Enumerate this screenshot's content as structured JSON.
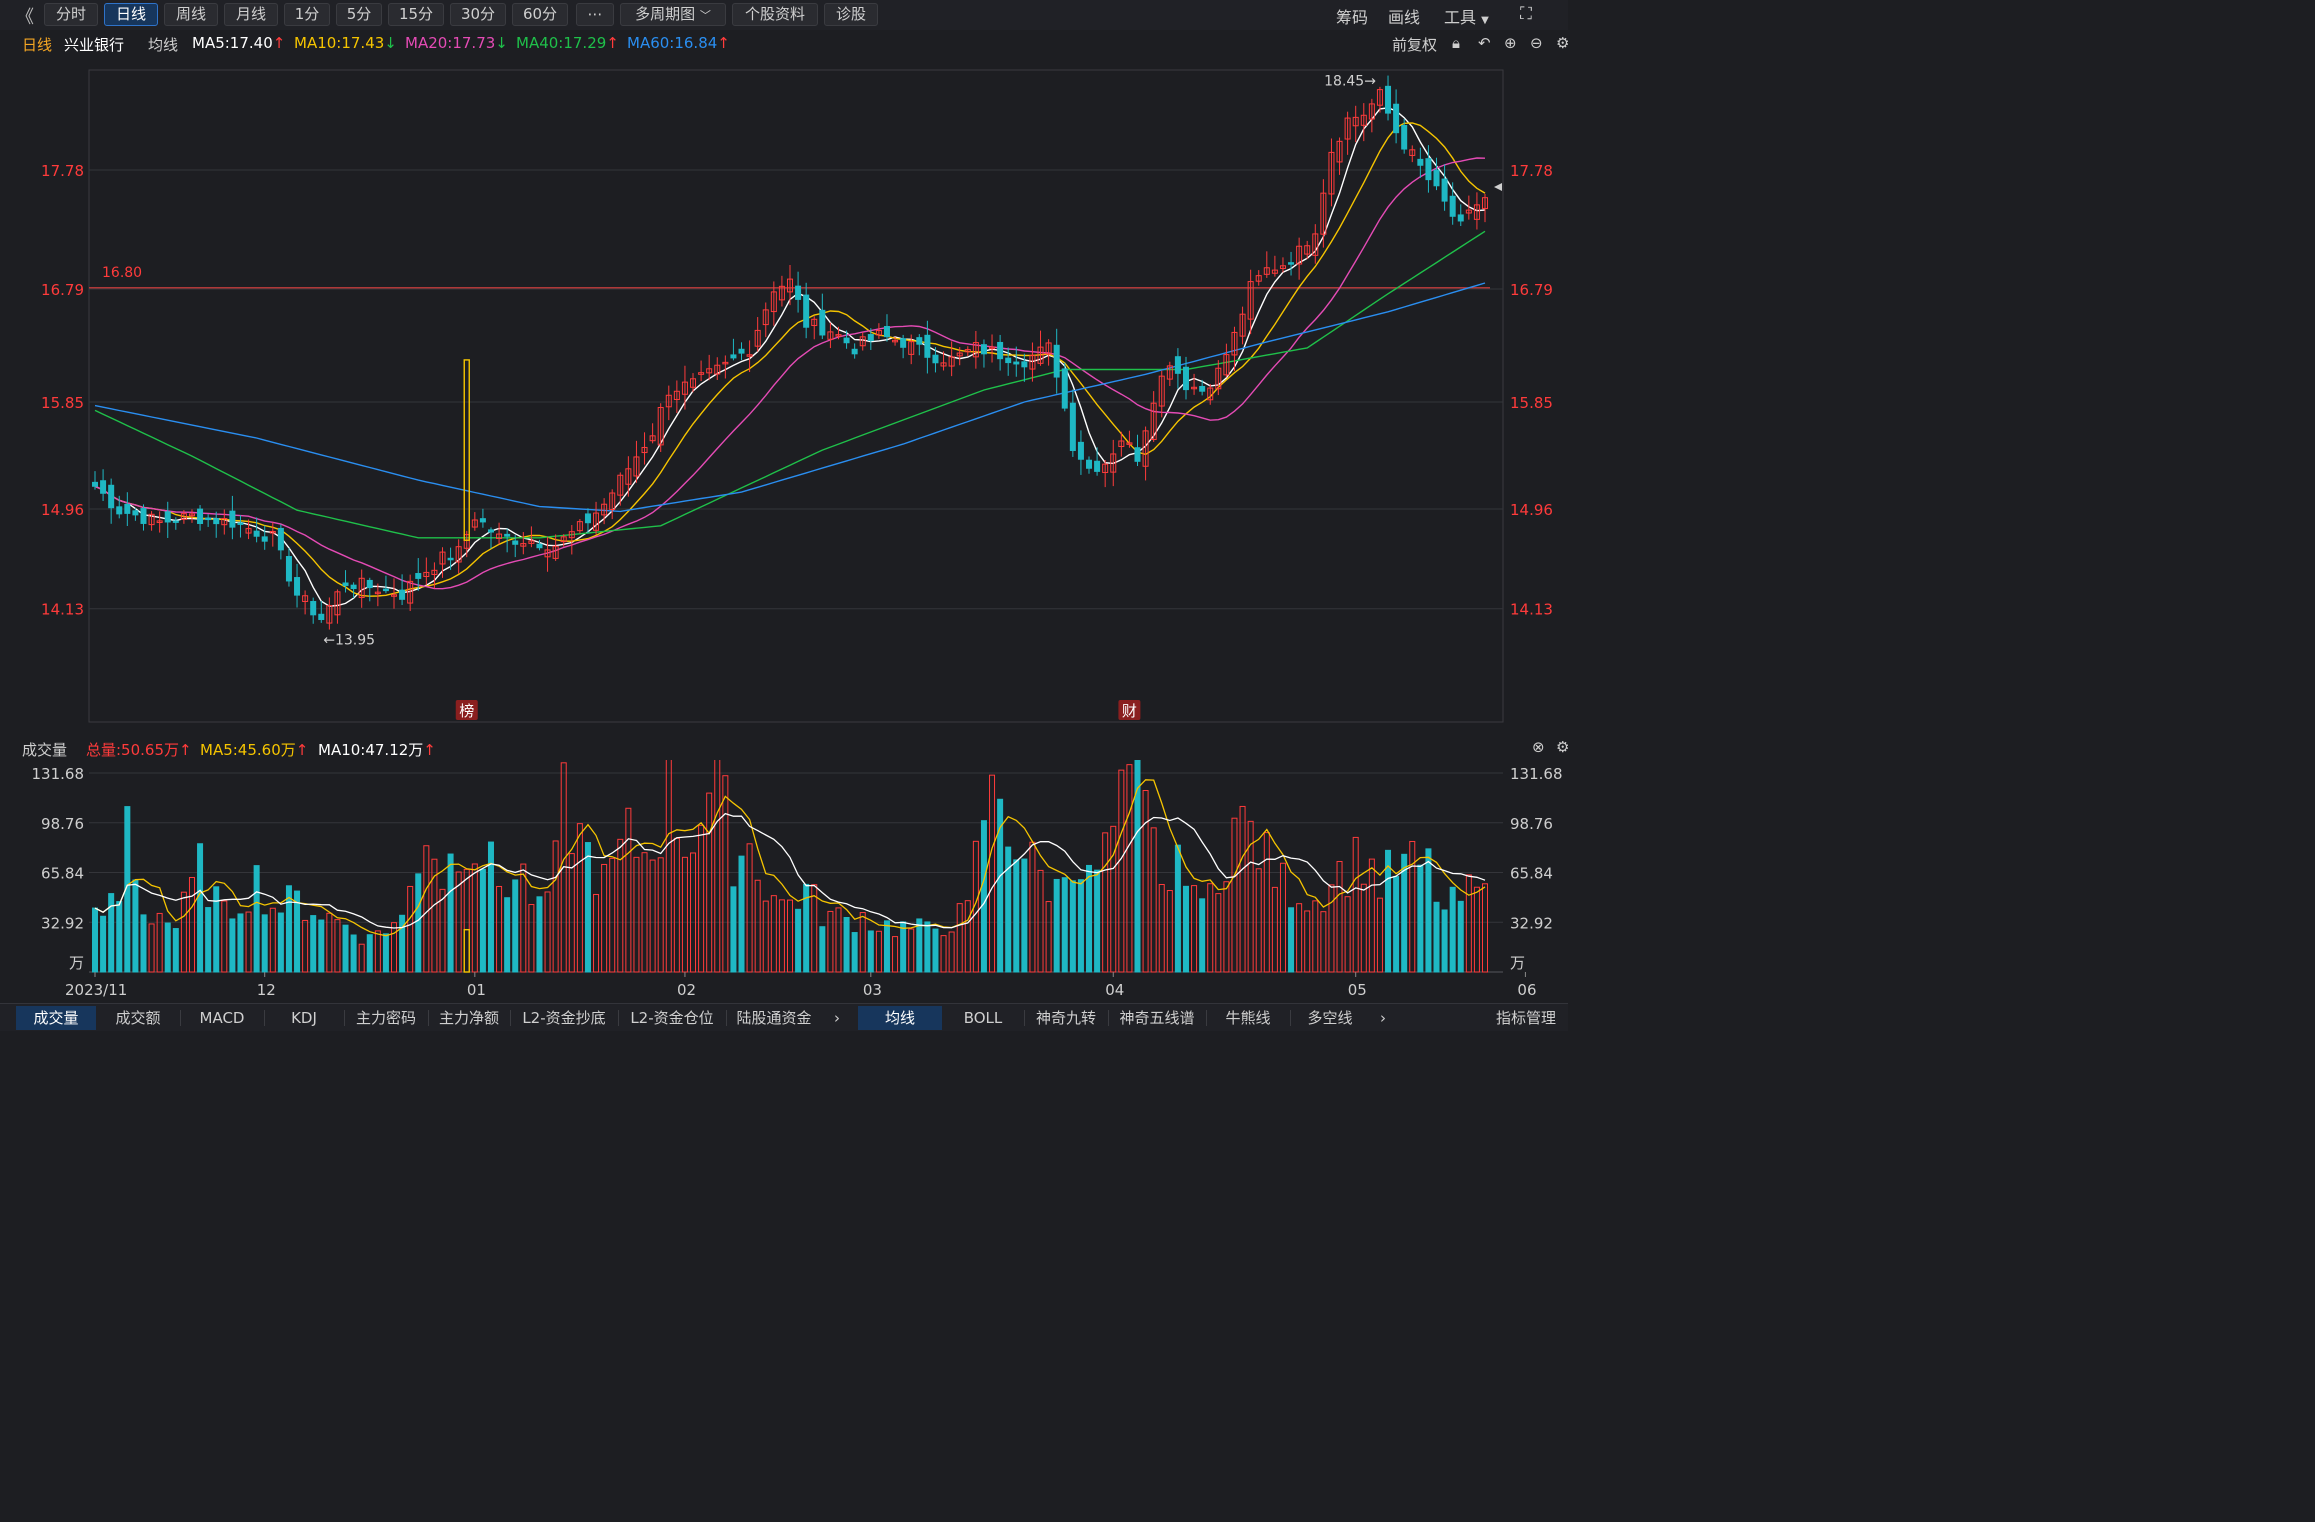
{
  "toolbar": {
    "tabs": [
      "分时",
      "日线",
      "周线",
      "月线",
      "1分",
      "5分",
      "15分",
      "30分",
      "60分"
    ],
    "active_tab": "日线",
    "more": "⋯",
    "multi_period": "多周期图",
    "profile": "个股资料",
    "diagnose": "诊股",
    "chips": "筹码",
    "draw": "画线",
    "tools": "工具"
  },
  "info": {
    "period": "日线",
    "stock": "兴业银行",
    "ma_label": "均线",
    "ma5": "MA5:17.40",
    "ma10": "MA10:17.43",
    "ma20": "MA20:17.73",
    "ma40": "MA40:17.29",
    "ma60": "MA60:16.84",
    "adjust": "前复权"
  },
  "volume_header": {
    "title": "成交量",
    "total": "总量:50.65万",
    "ma5": "MA5:45.60万",
    "ma10": "MA10:47.12万"
  },
  "bottom_tabs_left": [
    "成交量",
    "成交额",
    "MACD",
    "KDJ",
    "主力密码",
    "主力净额",
    "L2-资金抄底",
    "L2-资金仓位",
    "陆股通资金"
  ],
  "bottom_tabs_right": [
    "均线",
    "BOLL",
    "神奇九转",
    "神奇五线谱",
    "牛熊线",
    "多空线"
  ],
  "indicator_manage": "指标管理",
  "colors": {
    "up": "#ff3b3b",
    "down": "#1fb8c4",
    "ma5": "#ffffff",
    "ma10": "#f5c400",
    "ma20": "#e44bb5",
    "ma40": "#1fc04a",
    "ma60": "#2a8ef0"
  },
  "chart_data": {
    "type": "candlestick",
    "price_ticks": [
      "17.78",
      "16.79",
      "15.85",
      "14.96",
      "14.13"
    ],
    "price_levels": [
      17.78,
      16.79,
      15.85,
      14.96,
      14.13
    ],
    "ref_line": {
      "label": "16.80",
      "value": 16.8
    },
    "high_marker": {
      "label": "18.45→",
      "value": 18.45
    },
    "low_marker": {
      "label": "←13.95",
      "value": 13.95
    },
    "event_marks": [
      {
        "label": "榜",
        "index": 46
      },
      {
        "label": "财",
        "index": 128
      }
    ],
    "x_labels": [
      {
        "label": "2023/11",
        "index": 0
      },
      {
        "label": "12",
        "index": 21
      },
      {
        "label": "01",
        "index": 47
      },
      {
        "label": "02",
        "index": 73
      },
      {
        "label": "03",
        "index": 96
      },
      {
        "label": "04",
        "index": 126
      },
      {
        "label": "05",
        "index": 156
      },
      {
        "label": "06",
        "index": 177
      }
    ],
    "close_anchors": [
      [
        0,
        15.15
      ],
      [
        3,
        14.95
      ],
      [
        8,
        14.85
      ],
      [
        12,
        14.9
      ],
      [
        17,
        14.85
      ],
      [
        22,
        14.72
      ],
      [
        25,
        14.25
      ],
      [
        28,
        14.05
      ],
      [
        31,
        14.35
      ],
      [
        35,
        14.3
      ],
      [
        38,
        14.25
      ],
      [
        40,
        14.4
      ],
      [
        43,
        14.55
      ],
      [
        45,
        14.6
      ],
      [
        47,
        14.9
      ],
      [
        50,
        14.72
      ],
      [
        54,
        14.7
      ],
      [
        57,
        14.66
      ],
      [
        60,
        14.8
      ],
      [
        63,
        15.0
      ],
      [
        66,
        15.3
      ],
      [
        69,
        15.6
      ],
      [
        71,
        15.95
      ],
      [
        74,
        16.0
      ],
      [
        78,
        16.15
      ],
      [
        81,
        16.3
      ],
      [
        84,
        16.8
      ],
      [
        86,
        16.85
      ],
      [
        88,
        16.5
      ],
      [
        91,
        16.45
      ],
      [
        94,
        16.3
      ],
      [
        97,
        16.4
      ],
      [
        100,
        16.35
      ],
      [
        103,
        16.25
      ],
      [
        106,
        16.2
      ],
      [
        109,
        16.3
      ],
      [
        112,
        16.25
      ],
      [
        115,
        16.2
      ],
      [
        118,
        16.3
      ],
      [
        119,
        16.1
      ],
      [
        121,
        15.5
      ],
      [
        123,
        15.3
      ],
      [
        125,
        15.35
      ],
      [
        127,
        15.55
      ],
      [
        129,
        15.4
      ],
      [
        131,
        15.9
      ],
      [
        133,
        16.2
      ],
      [
        135,
        16.0
      ],
      [
        137,
        15.95
      ],
      [
        139,
        16.1
      ],
      [
        141,
        16.4
      ],
      [
        143,
        16.8
      ],
      [
        145,
        16.95
      ],
      [
        147,
        17.0
      ],
      [
        149,
        17.1
      ],
      [
        151,
        17.3
      ],
      [
        153,
        17.95
      ],
      [
        155,
        18.2
      ],
      [
        157,
        18.25
      ],
      [
        159,
        18.4
      ],
      [
        161,
        18.1
      ],
      [
        163,
        17.9
      ],
      [
        165,
        17.7
      ],
      [
        167,
        17.5
      ],
      [
        169,
        17.3
      ],
      [
        171,
        17.5
      ],
      [
        172,
        17.55
      ]
    ],
    "ma_series": [
      {
        "name": "MA5",
        "value": 17.4
      },
      {
        "name": "MA10",
        "value": 17.43
      },
      {
        "name": "MA20",
        "value": 17.73
      },
      {
        "name": "MA40",
        "value": 17.29
      },
      {
        "name": "MA60",
        "value": 16.84
      }
    ],
    "volume": {
      "unit": "万",
      "ticks": [
        "131.68",
        "98.76",
        "65.84",
        "32.92",
        "万"
      ],
      "levels": [
        131.68,
        98.76,
        65.84,
        32.92
      ],
      "anchors": [
        [
          0,
          35
        ],
        [
          3,
          50
        ],
        [
          4,
          105
        ],
        [
          6,
          40
        ],
        [
          8,
          40
        ],
        [
          10,
          30
        ],
        [
          13,
          70
        ],
        [
          16,
          38
        ],
        [
          20,
          62
        ],
        [
          22,
          44
        ],
        [
          25,
          48
        ],
        [
          28,
          40
        ],
        [
          31,
          32
        ],
        [
          34,
          22
        ],
        [
          35,
          28
        ],
        [
          38,
          35
        ],
        [
          41,
          100
        ],
        [
          43,
          65
        ],
        [
          46,
          95
        ],
        [
          48,
          80
        ],
        [
          50,
          60
        ],
        [
          53,
          65
        ],
        [
          55,
          40
        ],
        [
          57,
          70
        ],
        [
          58,
          115
        ],
        [
          60,
          90
        ],
        [
          63,
          60
        ],
        [
          66,
          90
        ],
        [
          68,
          80
        ],
        [
          70,
          100
        ],
        [
          71,
          130
        ],
        [
          73,
          85
        ],
        [
          75,
          110
        ],
        [
          77,
          131
        ],
        [
          79,
          80
        ],
        [
          81,
          85
        ],
        [
          83,
          60
        ],
        [
          85,
          45
        ],
        [
          88,
          55
        ],
        [
          90,
          40
        ],
        [
          93,
          35
        ],
        [
          95,
          38
        ],
        [
          97,
          32
        ],
        [
          100,
          30
        ],
        [
          103,
          28
        ],
        [
          106,
          35
        ],
        [
          108,
          40
        ],
        [
          110,
          110
        ],
        [
          112,
          120
        ],
        [
          113,
          100
        ],
        [
          115,
          80
        ],
        [
          117,
          65
        ],
        [
          119,
          55
        ],
        [
          121,
          85
        ],
        [
          123,
          60
        ],
        [
          125,
          80
        ],
        [
          127,
          110
        ],
        [
          129,
          125
        ],
        [
          131,
          85
        ],
        [
          133,
          55
        ],
        [
          135,
          80
        ],
        [
          137,
          40
        ],
        [
          139,
          70
        ],
        [
          141,
          100
        ],
        [
          143,
          95
        ],
        [
          145,
          75
        ],
        [
          147,
          60
        ],
        [
          149,
          55
        ],
        [
          151,
          48
        ],
        [
          153,
          65
        ],
        [
          155,
          70
        ],
        [
          157,
          80
        ],
        [
          159,
          60
        ],
        [
          161,
          70
        ],
        [
          163,
          72
        ],
        [
          165,
          70
        ],
        [
          167,
          40
        ],
        [
          169,
          50
        ],
        [
          171,
          55
        ],
        [
          172,
          50
        ]
      ]
    }
  }
}
